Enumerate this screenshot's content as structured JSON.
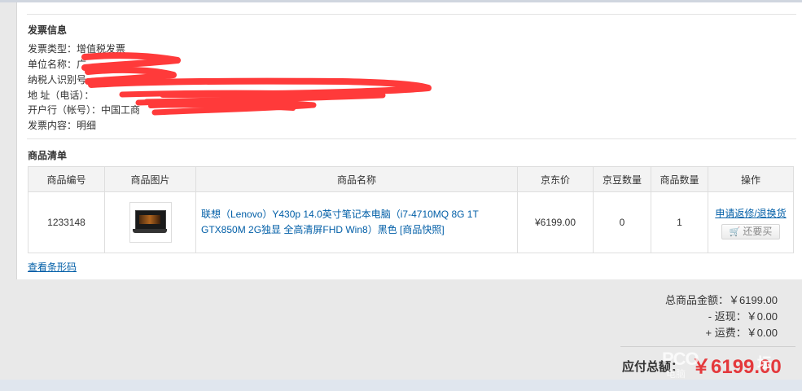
{
  "invoice": {
    "title": "发票信息",
    "lines": [
      "发票类型：增值税发票",
      "单位名称：广",
      "纳税人识别号",
      "地  址（电话）：",
      "开户行（帐号）：中国工商",
      "发票内容：明细"
    ]
  },
  "goods": {
    "title": "商品清单",
    "headers": [
      "商品编号",
      "商品图片",
      "商品名称",
      "京东价",
      "京豆数量",
      "商品数量",
      "操作"
    ],
    "row": {
      "id": "1233148",
      "name": "联想（Lenovo）Y430p 14.0英寸笔记本电脑（i7-4710MQ 8G 1T GTX850M 2G独显 全高清屏FHD Win8）黑色",
      "snapshot": "[商品快照]",
      "price": "¥6199.00",
      "jingdou": "0",
      "qty": "1",
      "op_repair": "申请返修/退换货",
      "op_rebuy": "还要买",
      "thumb_icon": "laptop-icon",
      "cart_icon": "cart-icon"
    },
    "barcode_link": "查看条形码"
  },
  "summary": {
    "subtotal": "总商品金额：￥6199.00",
    "cashback": "- 返现：￥0.00",
    "shipping": "+ 运费：￥0.00",
    "total_label": "应付总额：",
    "total_value": "￥6199.00",
    "watermark_main": "PCO",
    "watermark_side": "坛",
    "watermark_sub": "电脑"
  },
  "colors": {
    "price_red": "#e4393c",
    "link_blue": "#005ea7"
  }
}
